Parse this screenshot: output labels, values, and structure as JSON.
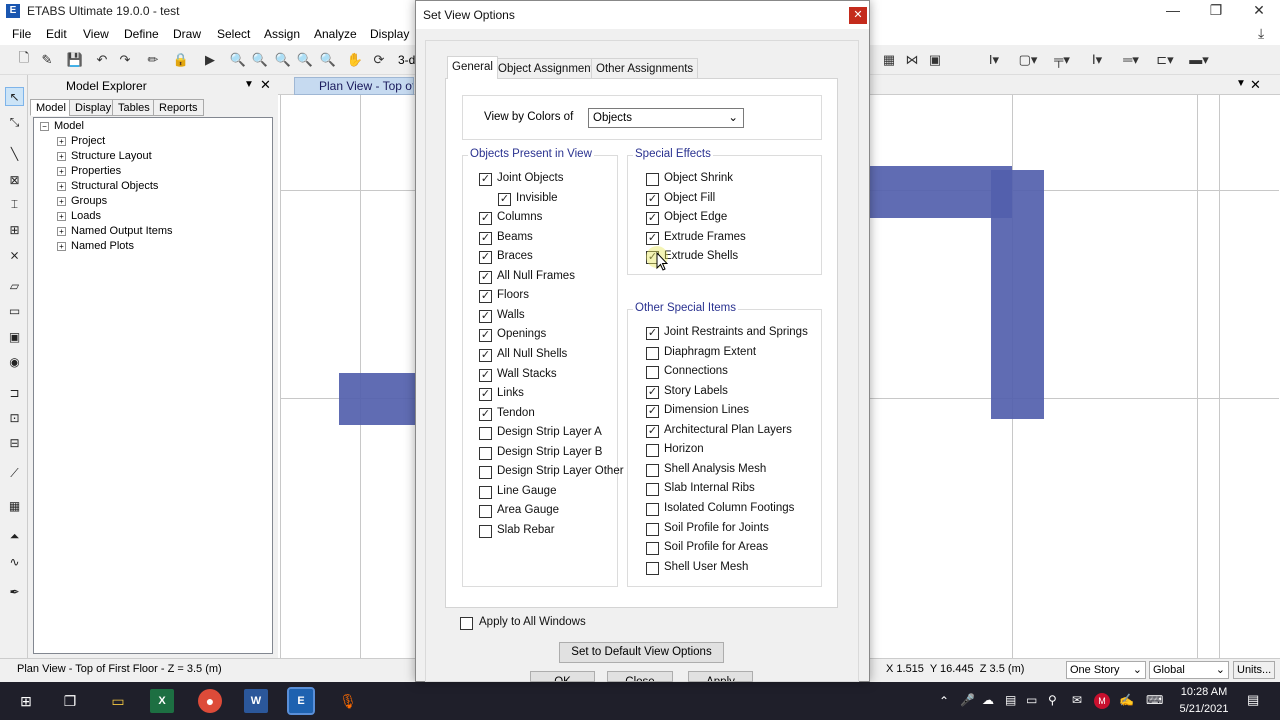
{
  "window": {
    "title": "ETABS Ultimate 19.0.0 - test",
    "logo_letter": "E"
  },
  "menu": [
    "File",
    "Edit",
    "View",
    "Define",
    "Draw",
    "Select",
    "Assign",
    "Analyze",
    "Display"
  ],
  "toolbar": {
    "view_3d_label": "3-d"
  },
  "explorer": {
    "title": "Model Explorer",
    "tabs": [
      "Model",
      "Display",
      "Tables",
      "Reports"
    ],
    "root": "Model",
    "items": [
      "Project",
      "Structure Layout",
      "Properties",
      "Structural Objects",
      "Groups",
      "Loads",
      "Named Output Items",
      "Named Plots"
    ]
  },
  "view": {
    "tab_title": "Plan View - Top of F"
  },
  "status": {
    "left": "Plan View - Top of First Floor - Z = 3.5 (m)",
    "coords": "X 1.515  Y 16.445  Z 3.5 (m)",
    "story": "One Story",
    "coord_sys": "Global",
    "units": "Units..."
  },
  "dialog": {
    "title": "Set View Options",
    "tabs": [
      "General",
      "Object Assignments",
      "Other Assignments"
    ],
    "view_by_label": "View by Colors of",
    "view_by_value": "Objects",
    "objects_present": {
      "title": "Objects Present in View",
      "items": [
        {
          "label": "Joint Objects",
          "checked": true
        },
        {
          "label": "Invisible",
          "checked": true,
          "indent": true
        },
        {
          "label": "Columns",
          "checked": true
        },
        {
          "label": "Beams",
          "checked": true
        },
        {
          "label": "Braces",
          "checked": true
        },
        {
          "label": "All Null Frames",
          "checked": true
        },
        {
          "label": "Floors",
          "checked": true
        },
        {
          "label": "Walls",
          "checked": true
        },
        {
          "label": "Openings",
          "checked": true
        },
        {
          "label": "All Null Shells",
          "checked": true
        },
        {
          "label": "Wall Stacks",
          "checked": true
        },
        {
          "label": "Links",
          "checked": true
        },
        {
          "label": "Tendon",
          "checked": true
        },
        {
          "label": "Design Strip Layer A",
          "checked": false
        },
        {
          "label": "Design Strip Layer B",
          "checked": false
        },
        {
          "label": "Design Strip Layer Other",
          "checked": false
        },
        {
          "label": "Line Gauge",
          "checked": false
        },
        {
          "label": "Area Gauge",
          "checked": false
        },
        {
          "label": "Slab Rebar",
          "checked": false
        }
      ]
    },
    "special_effects": {
      "title": "Special Effects",
      "items": [
        {
          "label": "Object Shrink",
          "checked": false
        },
        {
          "label": "Object Fill",
          "checked": true
        },
        {
          "label": "Object Edge",
          "checked": true
        },
        {
          "label": "Extrude Frames",
          "checked": true
        },
        {
          "label": "Extrude Shells",
          "checked": true
        }
      ]
    },
    "other_special": {
      "title": "Other Special Items",
      "items": [
        {
          "label": "Joint Restraints and Springs",
          "checked": true
        },
        {
          "label": "Diaphragm Extent",
          "checked": false
        },
        {
          "label": "Connections",
          "checked": false
        },
        {
          "label": "Story Labels",
          "checked": true
        },
        {
          "label": "Dimension Lines",
          "checked": true
        },
        {
          "label": "Architectural Plan Layers",
          "checked": true
        },
        {
          "label": "Horizon",
          "checked": false
        },
        {
          "label": "Shell Analysis Mesh",
          "checked": false
        },
        {
          "label": "Slab Internal Ribs",
          "checked": false
        },
        {
          "label": "Isolated Column Footings",
          "checked": false
        },
        {
          "label": "Soil Profile for Joints",
          "checked": false
        },
        {
          "label": "Soil Profile for Areas",
          "checked": false
        },
        {
          "label": "Shell User Mesh",
          "checked": false
        }
      ]
    },
    "apply_all": {
      "label": "Apply to All Windows",
      "checked": false
    },
    "default_button": "Set to Default View Options",
    "ok": "OK",
    "close": "Close",
    "apply": "Apply"
  },
  "taskbar": {
    "time": "10:28 AM",
    "date": "5/21/2021"
  },
  "colors": {
    "shape_fill": "#5260ad",
    "dialog_group_title": "#2a3290"
  }
}
